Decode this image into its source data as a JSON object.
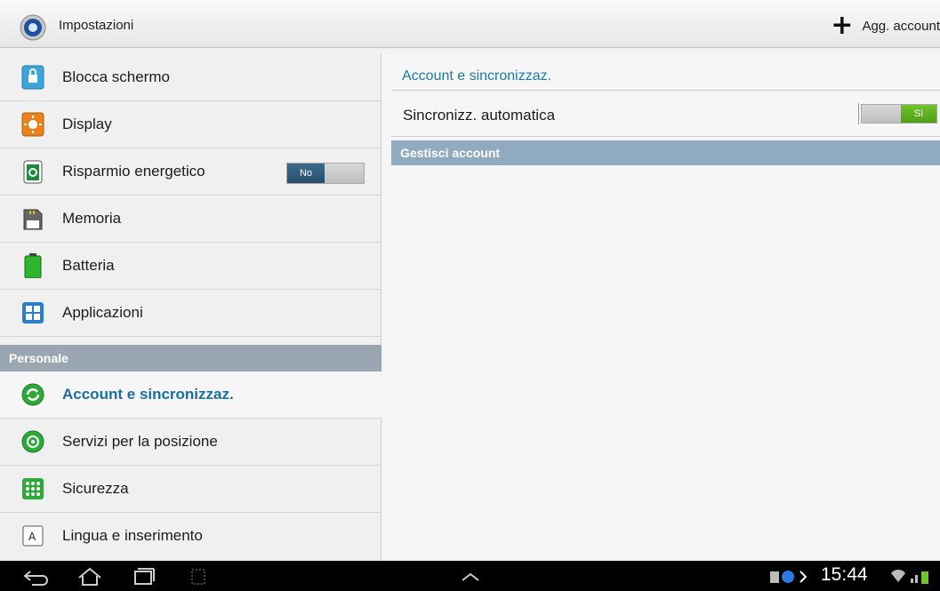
{
  "app": {
    "title": "Impostazioni",
    "add_account": "Agg. account"
  },
  "sidebar": {
    "items": [
      {
        "label": "Blocca schermo",
        "icon": "lock-icon"
      },
      {
        "label": "Display",
        "icon": "display-icon"
      },
      {
        "label": "Risparmio energetico",
        "icon": "power-saving-icon",
        "toggle": "No"
      },
      {
        "label": "Memoria",
        "icon": "storage-icon"
      },
      {
        "label": "Batteria",
        "icon": "battery-icon"
      },
      {
        "label": "Applicazioni",
        "icon": "apps-icon"
      }
    ],
    "section": "Personale",
    "personal_items": [
      {
        "label": "Account e sincronizzaz.",
        "icon": "sync-icon",
        "selected": true
      },
      {
        "label": "Servizi per la posizione",
        "icon": "location-icon"
      },
      {
        "label": "Sicurezza",
        "icon": "security-icon"
      },
      {
        "label": "Lingua e inserimento",
        "icon": "language-icon"
      }
    ]
  },
  "main": {
    "category": "Account e sincronizzaz.",
    "auto_sync": {
      "label": "Sincronizz. automatica",
      "state": "Sì"
    },
    "manage_header": "Gestisci account"
  },
  "statusbar": {
    "time": "15:44"
  },
  "colors": {
    "accent": "#1a7aab",
    "section_bg": "#9aa7b3",
    "toggle_on": "#5aaf1e",
    "toggle_off": "#2f5b79"
  }
}
